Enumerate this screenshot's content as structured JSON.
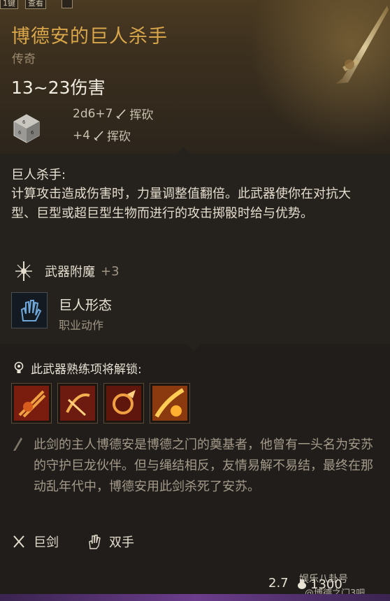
{
  "top_chips": {
    "chip_a": "1键",
    "chip_b": "查看"
  },
  "item": {
    "name": "博德安的巨人杀手",
    "rarity": "传奇",
    "damage": "13~23伤害",
    "damage_lines": [
      {
        "dice": "2d6+7",
        "type": "挥砍"
      },
      {
        "dice": "+4",
        "type": "挥砍"
      }
    ]
  },
  "passive": {
    "title": "巨人杀手:",
    "description": "计算攻击造成伤害时，力量调整值翻倍。此武器使你在对抗大型、巨型或超巨型生物而进行的攻击掷骰时给与优势。"
  },
  "enchant": {
    "label": "武器附魔",
    "value": "+3"
  },
  "action": {
    "name": "巨人形态",
    "subtitle": "职业动作"
  },
  "proficiency": {
    "label": "此武器熟练项将解锁:"
  },
  "skills": [
    {
      "icon": "cleave-skill-icon"
    },
    {
      "icon": "lacerate-skill-icon"
    },
    {
      "icon": "rush-attack-skill-icon"
    },
    {
      "icon": "prepare-skill-icon"
    }
  ],
  "lore": "此剑的主人博德安是博德之门的奠基者，他曾有一头名为安苏的守护巨龙伙伴。但与绳结相反，友情易解不易结，最终在那动乱年代中，博德安用此剑杀死了安苏。",
  "properties": [
    {
      "icon": "greatsword-icon",
      "label": "巨剑"
    },
    {
      "icon": "two-handed-icon",
      "label": "双手"
    }
  ],
  "footer": {
    "weight": "2.7",
    "price": "1300",
    "watermark_top": "娱乐八卦号",
    "watermark_bottom": "@博德之门3吧"
  },
  "colors": {
    "title": "#d9a64a",
    "footer_accent": "#6b3d8c"
  }
}
